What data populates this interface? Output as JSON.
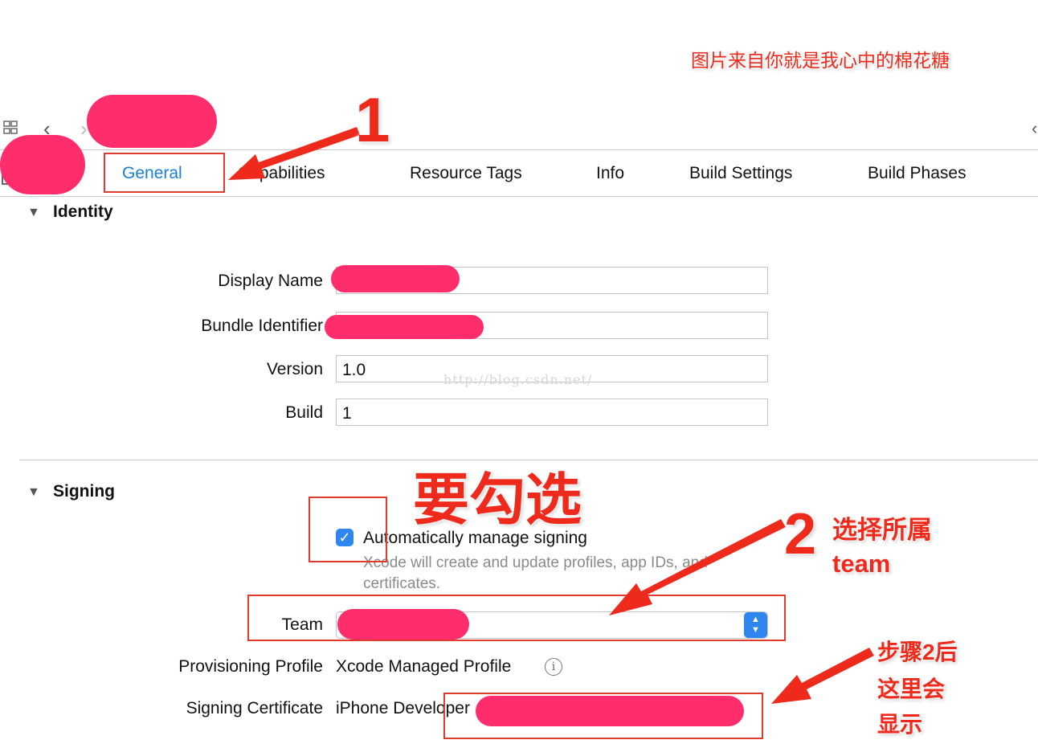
{
  "caption": "图片来自你就是我心中的棉花糖",
  "tabs": [
    {
      "label": "General",
      "active": true
    },
    {
      "label": "Capabilities"
    },
    {
      "label": "Resource Tags"
    },
    {
      "label": "Info"
    },
    {
      "label": "Build Settings"
    },
    {
      "label": "Build Phases"
    }
  ],
  "identity": {
    "title": "Identity",
    "display_name_label": "Display Name",
    "bundle_identifier_label": "Bundle Identifier",
    "version_label": "Version",
    "version_value": "1.0",
    "build_label": "Build",
    "build_value": "1"
  },
  "signing": {
    "title": "Signing",
    "auto_manage_label": "Automatically manage signing",
    "auto_manage_checked": true,
    "auto_manage_help": "Xcode will create and update profiles, app IDs, and certificates.",
    "team_label": "Team",
    "provisioning_label": "Provisioning Profile",
    "provisioning_value": "Xcode Managed Profile",
    "certificate_label": "Signing Certificate",
    "certificate_value": "iPhone Developer"
  },
  "watermark": "http://blog.csdn.net/",
  "annotations": {
    "step1": "1",
    "must_check": "要勾选",
    "step2": "2",
    "step2_text_line1": "选择所属",
    "step2_text_line2": "team",
    "after_line1": "步骤2后",
    "after_line2": "这里会",
    "after_line3": "显示"
  },
  "colors": {
    "accent": "#1a7fd8",
    "annotation_red": "#ee2a1c",
    "redaction_pink": "#ff2d6b"
  }
}
